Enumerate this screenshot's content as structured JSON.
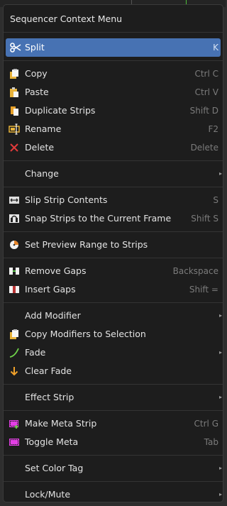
{
  "title": "Sequencer Context Menu",
  "colors": {
    "highlight": "#4772b3",
    "menu_bg": "#1d1d1d",
    "delete_x": "#e23b3b",
    "fade_green": "#6fd44a",
    "arrow_orange": "#f0a12a",
    "meta_magenta": "#e43fe6"
  },
  "items": {
    "split": {
      "label": "Split",
      "shortcut": "K",
      "icon": "scissors-icon"
    },
    "copy": {
      "label": "Copy",
      "shortcut": "Ctrl C",
      "icon": "copy-icon"
    },
    "paste": {
      "label": "Paste",
      "shortcut": "Ctrl V",
      "icon": "paste-icon"
    },
    "duplicate": {
      "label": "Duplicate Strips",
      "shortcut": "Shift D",
      "icon": "duplicate-icon"
    },
    "rename": {
      "label": "Rename",
      "shortcut": "F2",
      "icon": "rename-icon"
    },
    "delete": {
      "label": "Delete",
      "shortcut": "Delete",
      "icon": "x-icon"
    },
    "change": {
      "label": "Change",
      "icon": "none"
    },
    "slip": {
      "label": "Slip Strip Contents",
      "shortcut": "S",
      "icon": "slip-icon"
    },
    "snap": {
      "label": "Snap Strips to the Current Frame",
      "shortcut": "Shift S",
      "icon": "snap-icon"
    },
    "preview_range": {
      "label": "Set Preview Range to Strips",
      "icon": "preview-range-icon"
    },
    "remove_gaps": {
      "label": "Remove Gaps",
      "shortcut": "Backspace",
      "icon": "remove-gaps-icon"
    },
    "insert_gaps": {
      "label": "Insert Gaps",
      "shortcut": "Shift =",
      "icon": "insert-gaps-icon"
    },
    "add_modifier": {
      "label": "Add Modifier",
      "icon": "none"
    },
    "copy_modifiers": {
      "label": "Copy Modifiers to Selection",
      "icon": "copy-icon"
    },
    "fade": {
      "label": "Fade",
      "icon": "fade-curve-icon"
    },
    "clear_fade": {
      "label": "Clear Fade",
      "icon": "down-arrow-icon"
    },
    "effect_strip": {
      "label": "Effect Strip",
      "icon": "none"
    },
    "make_meta": {
      "label": "Make Meta Strip",
      "shortcut": "Ctrl G",
      "icon": "make-meta-icon"
    },
    "toggle_meta": {
      "label": "Toggle Meta",
      "shortcut": "Tab",
      "icon": "toggle-meta-icon"
    },
    "color_tag": {
      "label": "Set Color Tag",
      "icon": "none"
    },
    "lock_mute": {
      "label": "Lock/Mute",
      "icon": "none"
    }
  },
  "submenu_arrow": "▸"
}
